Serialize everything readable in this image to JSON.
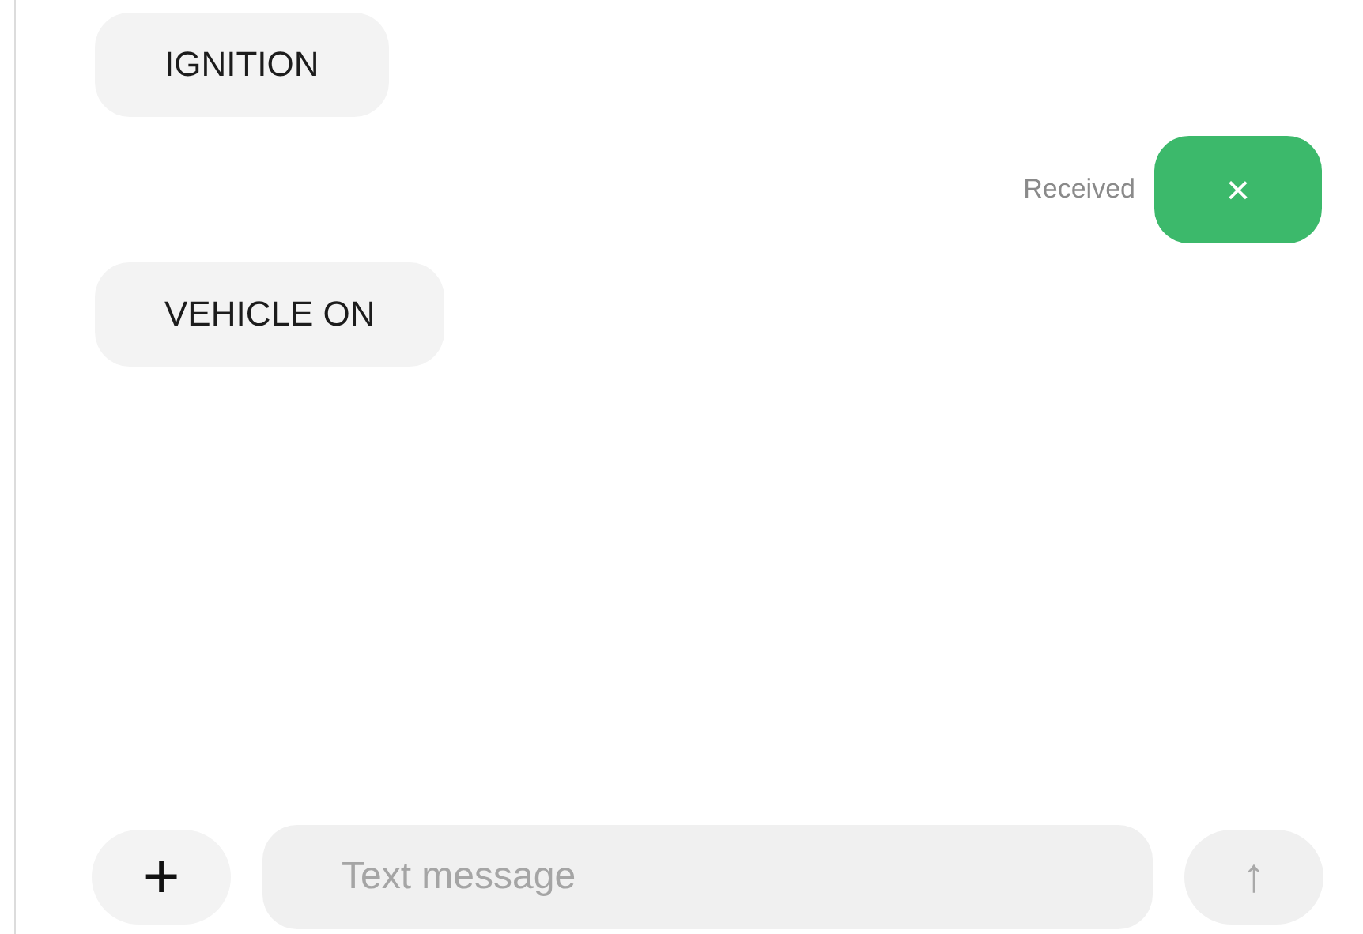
{
  "messages": [
    {
      "kind": "incoming",
      "text": "IGNITION"
    },
    {
      "kind": "outgoing",
      "text": "×",
      "status": "Received"
    },
    {
      "kind": "incoming",
      "text": "VEHICLE ON"
    }
  ],
  "composer": {
    "add": "+",
    "placeholder": "Text message",
    "send": "↑"
  }
}
